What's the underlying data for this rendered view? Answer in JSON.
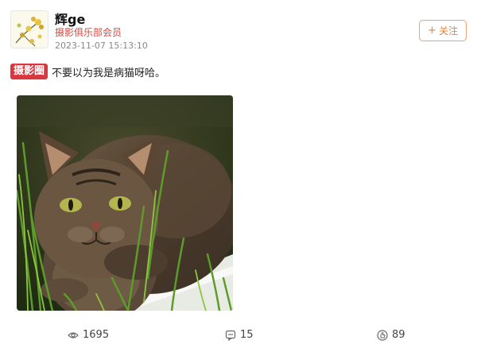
{
  "user": {
    "name": "辉ge",
    "tag": "摄影俱乐部会员",
    "timestamp": "2023-11-07 15:13:10"
  },
  "follow": {
    "label": "关注"
  },
  "post": {
    "topic": "摄影圈",
    "text": "不要以为我是病猫呀哈。"
  },
  "stats": {
    "views": "1695",
    "comments": "15",
    "likes": "89"
  },
  "colors": {
    "accent_red": "#d9363e",
    "follow_orange": "#f08133",
    "tag_red": "#d7483f"
  },
  "icons": {
    "views": "eye-icon",
    "comments": "comment-icon",
    "likes": "thumbs-up-icon",
    "follow": "plus-icon"
  }
}
